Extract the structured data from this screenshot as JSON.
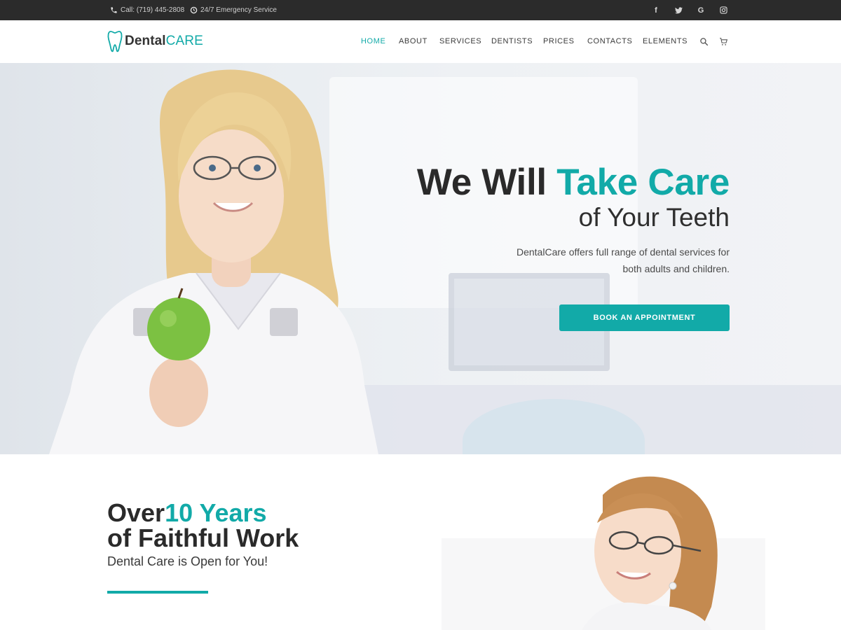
{
  "topbar": {
    "phone": "Call: (719) 445-2808",
    "emergency": "24/7 Emergency Service",
    "social": [
      {
        "icon": "facebook-icon",
        "glyph": "f"
      },
      {
        "icon": "twitter-icon",
        "glyph": "t"
      },
      {
        "icon": "google-icon",
        "glyph": "G"
      },
      {
        "icon": "instagram-icon",
        "glyph": "◎"
      }
    ]
  },
  "logo": {
    "part1": "Dental",
    "part2": "CARE"
  },
  "nav": {
    "items": [
      {
        "label": "HOME",
        "active": true
      },
      {
        "label": "ABOUT",
        "active": false
      },
      {
        "label": "SERVICES",
        "active": false
      },
      {
        "label": "DENTISTS",
        "active": false
      },
      {
        "label": "PRICES",
        "active": false
      },
      {
        "label": "CONTACTS",
        "active": false
      },
      {
        "label": "ELEMENTS",
        "active": false
      }
    ],
    "icons": [
      "search-icon",
      "cart-icon"
    ]
  },
  "hero": {
    "title_plain": "We Will ",
    "title_highlight": "Take Care",
    "subtitle": "of Your Teeth",
    "description": "DentalCare offers full range of dental services for both adults and children.",
    "button": "BOOK AN APPOINTMENT"
  },
  "section2": {
    "line1_plain": "Over",
    "line1_highlight": "10 Years",
    "line2": "of Faithful Work",
    "subtitle": "Dental Care is Open for You!"
  },
  "colors": {
    "accent": "#12aaa8",
    "topbar_bg": "#2b2b2b",
    "text_dark": "#2a2a2a"
  }
}
